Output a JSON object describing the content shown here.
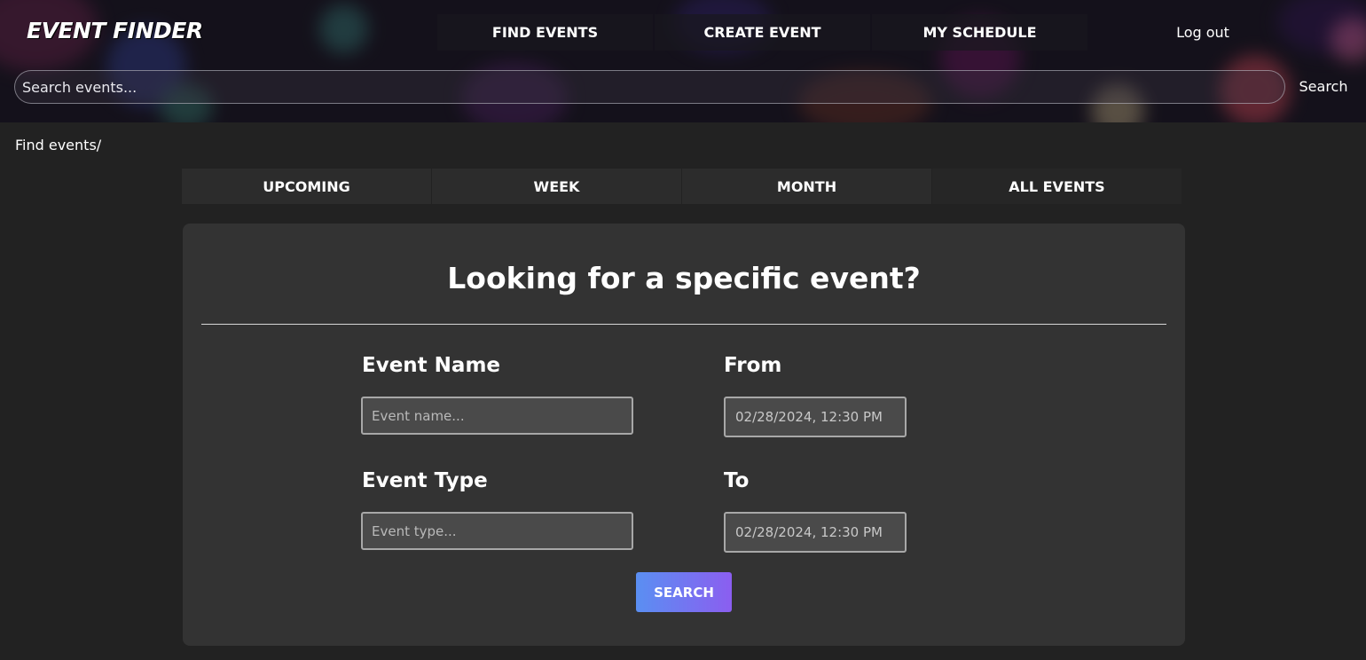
{
  "header": {
    "logo": "EVENT FINDER",
    "nav": [
      "FIND EVENTS",
      "CREATE EVENT",
      "MY SCHEDULE"
    ],
    "logout_label": "Log out",
    "search_placeholder": "Search events...",
    "search_label": "Search"
  },
  "breadcrumb": "Find events/",
  "tabs": [
    "UPCOMING",
    "WEEK",
    "MONTH",
    "ALL EVENTS"
  ],
  "card": {
    "title": "Looking for a specific event?",
    "event_name_label": "Event Name",
    "event_name_placeholder": "Event name...",
    "event_type_label": "Event Type",
    "event_type_placeholder": "Event type...",
    "from_label": "From",
    "from_value": "02/28/2024, 12:30 PM",
    "to_label": "To",
    "to_value": "02/28/2024, 12:30 PM",
    "submit_label": "SEARCH"
  },
  "colors": {
    "page_bg": "#222222",
    "card_bg": "#333333",
    "button_gradient_start": "#5a8ff2",
    "button_gradient_end": "#8b5ef0"
  }
}
